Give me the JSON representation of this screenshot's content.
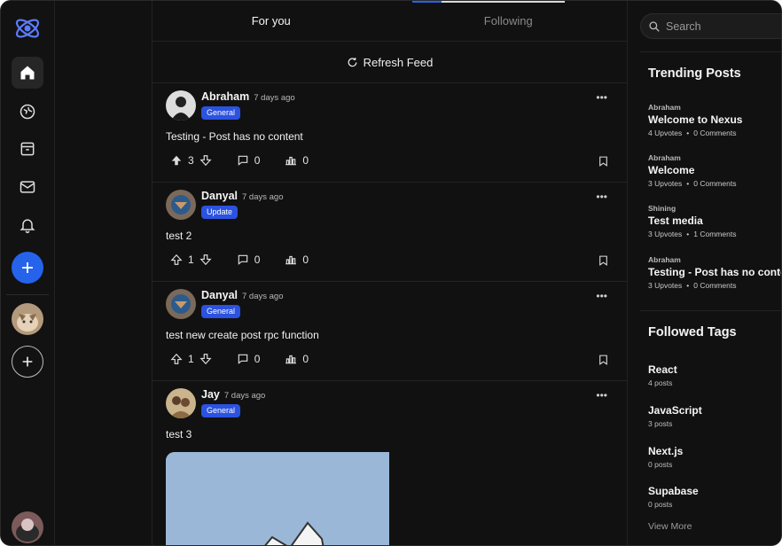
{
  "nav": {
    "items": [
      "logo-icon",
      "home-icon",
      "explore-icon",
      "archive-icon",
      "mail-icon",
      "bell-icon",
      "plus-icon",
      "plus-circle-icon"
    ]
  },
  "feed": {
    "tabs": [
      {
        "label": "For you",
        "active": true
      },
      {
        "label": "Following",
        "active": false
      }
    ],
    "refresh_label": "Refresh Feed",
    "posts": [
      {
        "author": "Abraham",
        "time": "7 days ago",
        "tag": "General",
        "content": "Testing - Post has no content",
        "upvotes": "3",
        "comments": "0",
        "stats": "0",
        "upvoted": true
      },
      {
        "author": "Danyal",
        "time": "7 days ago",
        "tag": "Update",
        "content": "test 2",
        "upvotes": "1",
        "comments": "0",
        "stats": "0",
        "upvoted": false
      },
      {
        "author": "Danyal",
        "time": "7 days ago",
        "tag": "General",
        "content": "test new create post rpc function",
        "upvotes": "1",
        "comments": "0",
        "stats": "0",
        "upvoted": false
      },
      {
        "author": "Jay",
        "time": "7 days ago",
        "tag": "General",
        "content": "test 3",
        "upvotes": "",
        "comments": "",
        "stats": "",
        "upvoted": false
      }
    ]
  },
  "sidebar": {
    "search_placeholder": "Search",
    "trending_title": "Trending Posts",
    "trending": [
      {
        "author": "Abraham",
        "title": "Welcome to Nexus",
        "upvotes": "4 Upvotes",
        "comments": "0 Comments"
      },
      {
        "author": "Abraham",
        "title": "Welcome",
        "upvotes": "3 Upvotes",
        "comments": "0 Comments"
      },
      {
        "author": "Shining",
        "title": "Test media",
        "upvotes": "3 Upvotes",
        "comments": "1 Comments"
      },
      {
        "author": "Abraham",
        "title": "Testing - Post has no content",
        "upvotes": "3 Upvotes",
        "comments": "0 Comments"
      }
    ],
    "tags_title": "Followed Tags",
    "tags": [
      {
        "name": "React",
        "count": "4 posts"
      },
      {
        "name": "JavaScript",
        "count": "3 posts"
      },
      {
        "name": "Next.js",
        "count": "0 posts"
      },
      {
        "name": "Supabase",
        "count": "0 posts"
      }
    ],
    "view_more": "View More"
  },
  "colors": {
    "accent": "#2563eb",
    "background": "#111111",
    "tag_bg": "#2b52e0"
  }
}
